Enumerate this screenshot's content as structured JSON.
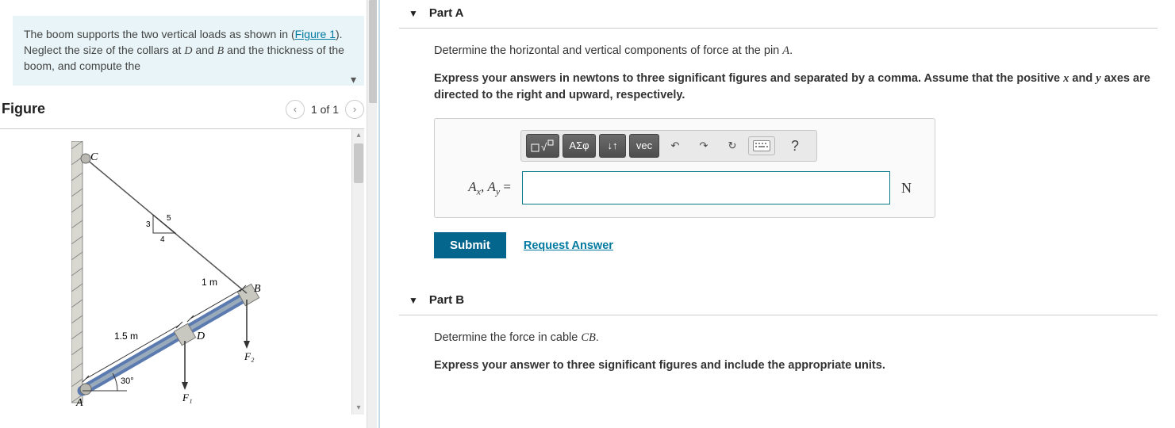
{
  "problem": {
    "text_pre": "The boom supports the two vertical loads as shown in (",
    "fig_link": "Figure 1",
    "text_mid": "). Neglect the size of the collars at ",
    "var_D": "D",
    "and1": " and ",
    "var_B": "B",
    "text_post": " and the thickness of the boom, and compute the"
  },
  "figure": {
    "title": "Figure",
    "pager": "1 of 1",
    "labels": {
      "C": "C",
      "B": "B",
      "D": "D",
      "A": "A",
      "len_1m": "1 m",
      "len_15m": "1.5 m",
      "ang": "30°",
      "F1": "F₁",
      "F2": "F₂",
      "tri_3": "3",
      "tri_4": "4",
      "tri_5": "5"
    }
  },
  "partA": {
    "title": "Part A",
    "prompt_pre": "Determine the horizontal and vertical components of force at the pin ",
    "prompt_var": "A",
    "prompt_post": ".",
    "instructions_pre": "Express your answers in newtons to three significant figures and separated by a comma. Assume that the positive ",
    "var_x": "x",
    "instructions_mid": " and ",
    "var_y": "y",
    "instructions_post": " axes are directed to the right and upward, respectively.",
    "toolbar": {
      "templates": "□√",
      "greek": "ΑΣφ",
      "subsup": "↓↑",
      "vec": "vec",
      "undo": "↶",
      "redo": "↷",
      "reset": "↻",
      "help": "?"
    },
    "answer_label_Ax": "A",
    "answer_label_sub_x": "x",
    "answer_label_sep": ", ",
    "answer_label_Ay": "A",
    "answer_label_sub_y": "y",
    "answer_label_eq": " =",
    "unit": "N",
    "submit": "Submit",
    "request": "Request Answer"
  },
  "partB": {
    "title": "Part B",
    "prompt_pre": "Determine the force in cable ",
    "prompt_var": "CB",
    "prompt_post": ".",
    "instructions": "Express your answer to three significant figures and include the appropriate units."
  }
}
